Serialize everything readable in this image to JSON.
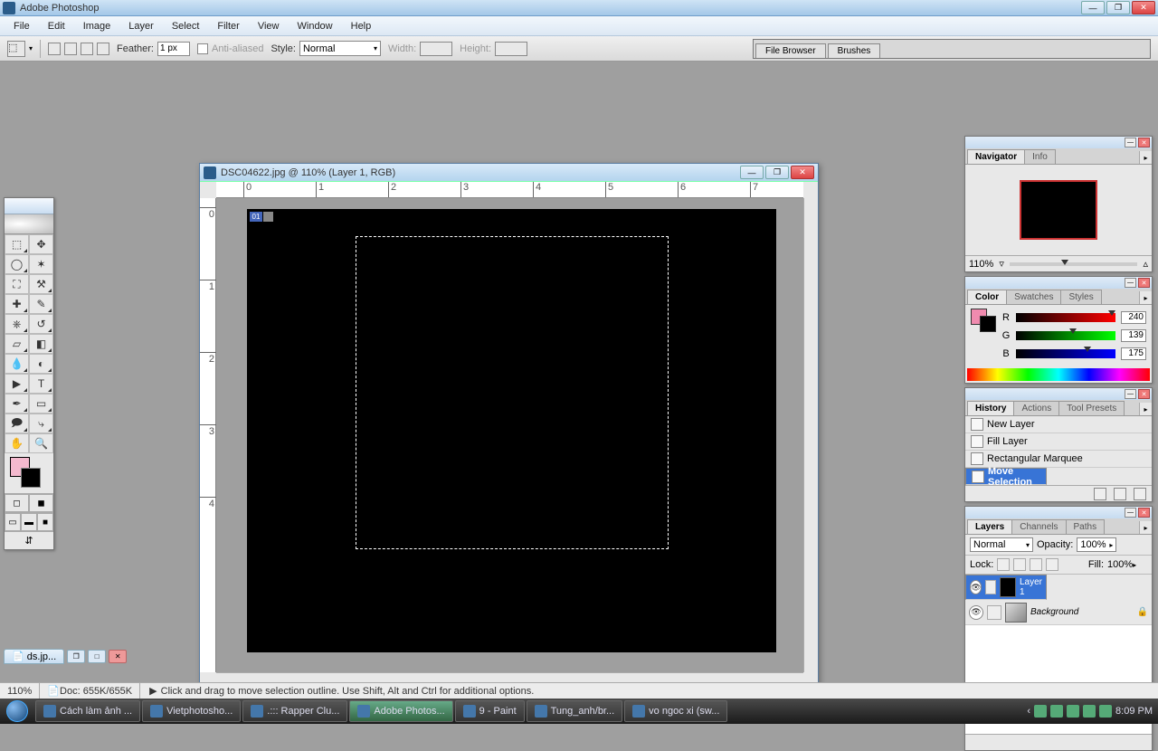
{
  "app": {
    "title": "Adobe Photoshop"
  },
  "menu": [
    "File",
    "Edit",
    "Image",
    "Layer",
    "Select",
    "Filter",
    "View",
    "Window",
    "Help"
  ],
  "options": {
    "feather_label": "Feather:",
    "feather_value": "1 px",
    "antialias_label": "Anti-aliased",
    "style_label": "Style:",
    "style_value": "Normal",
    "width_label": "Width:",
    "height_label": "Height:"
  },
  "dock_tabs": [
    "File Browser",
    "Brushes"
  ],
  "document": {
    "title": "DSC04622.jpg @ 110% (Layer 1, RGB)",
    "slice": "01",
    "ruler_h": [
      "0",
      "1",
      "2",
      "3",
      "4",
      "5",
      "6",
      "7"
    ],
    "ruler_v": [
      "0",
      "1",
      "2",
      "3",
      "4"
    ]
  },
  "navigator": {
    "tab1": "Navigator",
    "tab2": "Info",
    "zoom": "110%"
  },
  "color": {
    "tab1": "Color",
    "tab2": "Swatches",
    "tab3": "Styles",
    "r_label": "R",
    "r_val": "240",
    "g_label": "G",
    "g_val": "139",
    "b_label": "B",
    "b_val": "175",
    "fg": "#F08BAF"
  },
  "history": {
    "tab1": "History",
    "tab2": "Actions",
    "tab3": "Tool Presets",
    "items": [
      {
        "label": "New Layer"
      },
      {
        "label": "Fill Layer"
      },
      {
        "label": "Rectangular Marquee"
      },
      {
        "label": "Move Selection"
      }
    ]
  },
  "layers": {
    "tab1": "Layers",
    "tab2": "Channels",
    "tab3": "Paths",
    "blend": "Normal",
    "opacity_label": "Opacity:",
    "opacity_val": "100%",
    "lock_label": "Lock:",
    "fill_label": "Fill:",
    "fill_val": "100%",
    "rows": [
      {
        "name": "Layer 1"
      },
      {
        "name": "Background"
      }
    ]
  },
  "minidoc": {
    "label": "ds.jp..."
  },
  "status": {
    "zoom": "110%",
    "doc": "Doc: 655K/655K",
    "hint": "Click and drag to move selection outline.  Use Shift, Alt and Ctrl for additional options."
  },
  "taskbar": {
    "items": [
      "Cách làm ảnh ...",
      "Vietphotosho...",
      ".::: Rapper Clu...",
      "Adobe Photos...",
      "9 - Paint",
      "Tung_anh/br...",
      "vo ngoc xi (sw..."
    ],
    "time": "8:09 PM"
  }
}
